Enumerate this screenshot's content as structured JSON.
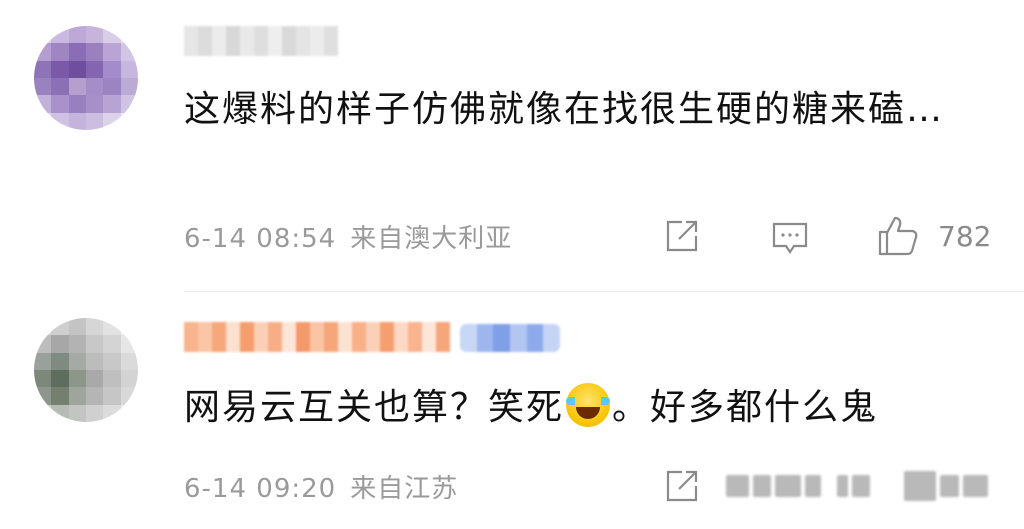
{
  "comments": [
    {
      "text": "这爆料的样子仿佛就像在找很生硬的糖来磕…",
      "time": "6-14 08:54",
      "source": "来自澳大利亚",
      "likes": "782",
      "icons": [
        "share-icon",
        "comment-icon",
        "thumbs-up-icon"
      ]
    },
    {
      "text_before": "网易云互关也算？笑死",
      "emoji": "laughing-crying-emoji",
      "text_after": "。好多都什么鬼",
      "time": "6-14 09:20",
      "source": "来自江苏",
      "icons": [
        "share-icon"
      ]
    }
  ],
  "colors": {
    "text": "#111111",
    "meta": "#9a9a9a",
    "divider": "#e8e8e8",
    "username_redacted_2": "#f7a77a"
  }
}
